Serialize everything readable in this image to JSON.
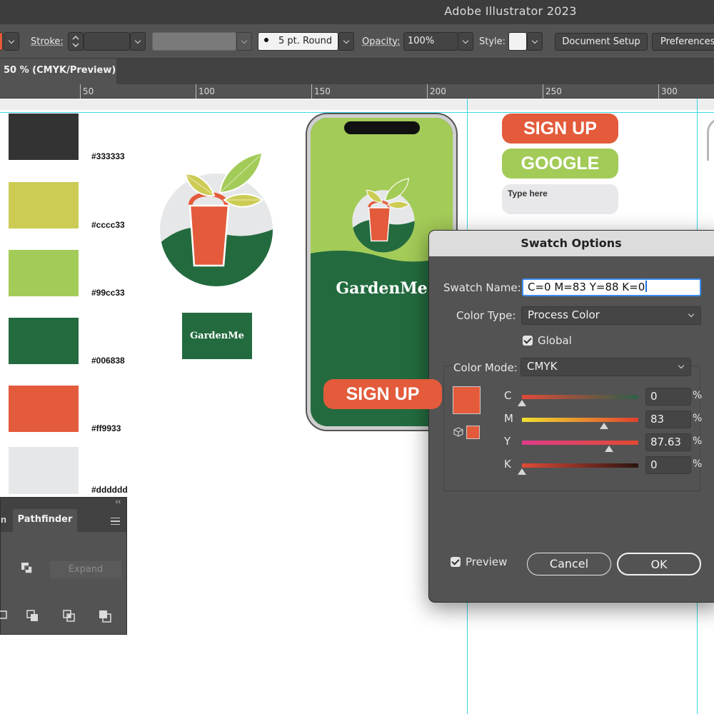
{
  "app": {
    "title": "Adobe Illustrator 2023"
  },
  "control_bar": {
    "stroke_label": "Stroke:",
    "brush_value": "5 pt. Round",
    "opacity_label": "Opacity:",
    "opacity_value": "100%",
    "style_label": "Style:",
    "document_setup": "Document Setup",
    "preferences": "Preferences"
  },
  "document_tab": {
    "label": "50 % (CMYK/Preview)"
  },
  "ruler": {
    "ticks": [
      "50",
      "100",
      "150",
      "200",
      "250",
      "300"
    ]
  },
  "swatches": [
    {
      "label": "#333333",
      "color": "#333333"
    },
    {
      "label": "#cccc33",
      "color": "#cccc55"
    },
    {
      "label": "#99cc33",
      "color": "#a3cb57"
    },
    {
      "label": "#006838",
      "color": "#236b3f"
    },
    {
      "label": "#ff9933",
      "color": "#e35b3b"
    },
    {
      "label": "#dddddd",
      "color": "#e6e7e8"
    }
  ],
  "brand": {
    "name": "GardenMe",
    "logo_rect_text": "GardenMe"
  },
  "phone": {
    "signup_label": "SIGN UP"
  },
  "kit": {
    "signup": "SIGN UP",
    "google": "GOOGLE",
    "input_placeholder": "Type here"
  },
  "pathfinder": {
    "tab_partial": "n",
    "tab_title": "Pathfinder",
    "expand": "Expand"
  },
  "dialog": {
    "title": "Swatch Options",
    "swatch_name_label": "Swatch Name:",
    "swatch_name_value": "C=0 M=83 Y=88 K=0",
    "color_type_label": "Color Type:",
    "color_type_value": "Process Color",
    "global_label": "Global",
    "color_mode_label": "Color Mode:",
    "color_mode_value": "CMYK",
    "preview_color": "#e35b3b",
    "channels": [
      {
        "label": "C",
        "value": "0",
        "unit": "%",
        "level": 0.0
      },
      {
        "label": "M",
        "value": "83",
        "unit": "%",
        "level": 0.83
      },
      {
        "label": "Y",
        "value": "87.63",
        "unit": "%",
        "level": 0.8763
      },
      {
        "label": "K",
        "value": "0",
        "unit": "%",
        "level": 0.0
      }
    ],
    "preview_label": "Preview",
    "cancel": "Cancel",
    "ok": "OK"
  }
}
